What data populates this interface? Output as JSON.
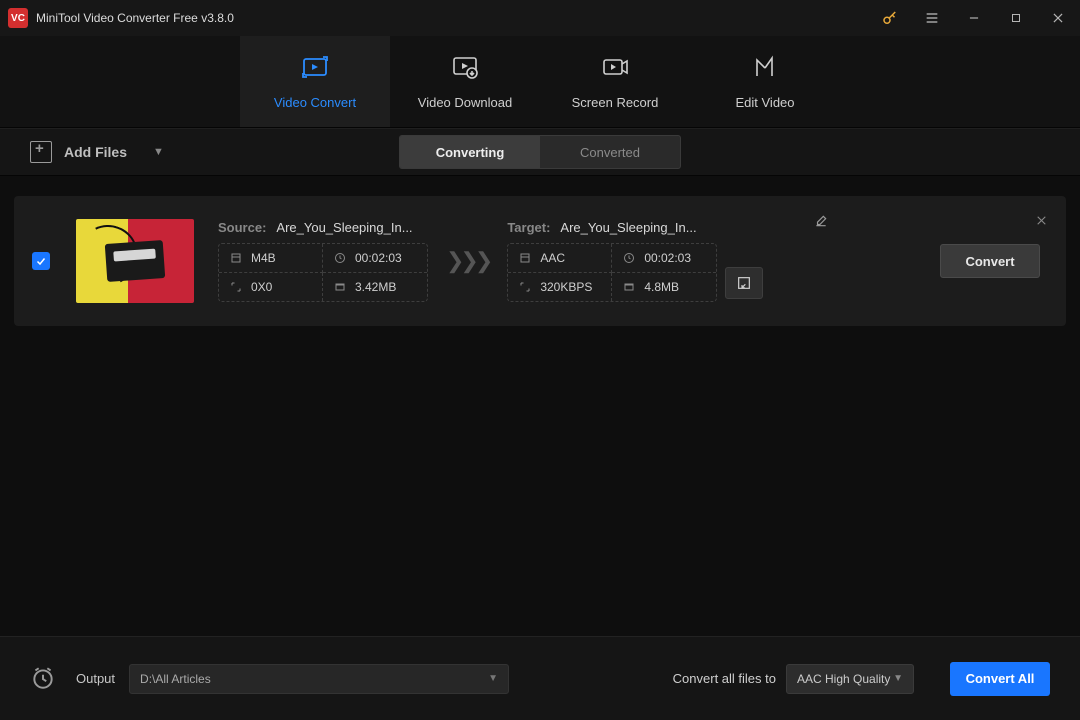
{
  "titlebar": {
    "app_logo_text": "VC",
    "app_title": "MiniTool Video Converter Free v3.8.0"
  },
  "tabs": {
    "convert": "Video Convert",
    "download": "Video Download",
    "record": "Screen Record",
    "edit": "Edit Video"
  },
  "toolbar": {
    "add_files": "Add Files",
    "seg_converting": "Converting",
    "seg_converted": "Converted"
  },
  "item": {
    "source_label": "Source:",
    "target_label": "Target:",
    "source_name": "Are_You_Sleeping_In...",
    "target_name": "Are_You_Sleeping_In...",
    "source": {
      "format": "M4B",
      "duration": "00:02:03",
      "resolution": "0X0",
      "size": "3.42MB"
    },
    "target": {
      "format": "AAC",
      "duration": "00:02:03",
      "bitrate": "320KBPS",
      "size": "4.8MB"
    },
    "convert_btn": "Convert"
  },
  "footer": {
    "output_label": "Output",
    "output_path": "D:\\All Articles",
    "convert_all_label": "Convert all files to",
    "format_selected": "AAC High Quality",
    "convert_all_btn": "Convert All"
  }
}
